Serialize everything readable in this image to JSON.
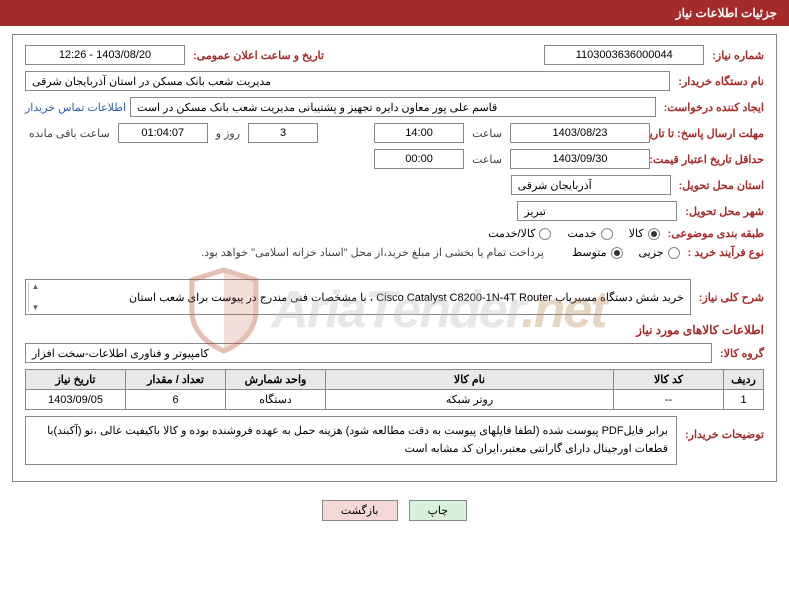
{
  "header": {
    "title": "جزئیات اطلاعات نیاز"
  },
  "fields": {
    "need_no_label": "شماره نیاز:",
    "need_no": "1103003636000044",
    "announce_label": "تاریخ و ساعت اعلان عمومی:",
    "announce_value": "1403/08/20 - 12:26",
    "buyer_org_label": "نام دستگاه خریدار:",
    "buyer_org": "مدیریت شعب بانک مسکن در استان آذربایجان شرقی",
    "requester_label": "ایجاد کننده درخواست:",
    "requester": "قاسم علی پور معاون دایره تجهیز و پشتیبانی مدیریت شعب بانک مسکن در است",
    "contact_link": "اطلاعات تماس خریدار",
    "deadline_send_label": "مهلت ارسال پاسخ: تا تاریخ:",
    "deadline_send_date": "1403/08/23",
    "time_label": "ساعت",
    "deadline_send_time": "14:00",
    "days_remain": "3",
    "days_and": "روز و",
    "time_remain": "01:04:07",
    "time_remain_suffix": "ساعت باقی مانده",
    "validity_label": "حداقل تاریخ اعتبار قیمت: تا تاریخ:",
    "validity_date": "1403/09/30",
    "validity_time": "00:00",
    "delivery_province_label": "استان محل تحویل:",
    "delivery_province": "آذربایجان شرقی",
    "delivery_city_label": "شهر محل تحویل:",
    "delivery_city": "تبریز",
    "category_label": "طبقه بندی موضوعی:",
    "radio_goods": "کالا",
    "radio_service": "خدمت",
    "radio_both": "کالا/خدمت",
    "purchase_type_label": "نوع فرآیند خرید :",
    "radio_minor": "جزیی",
    "radio_medium": "متوسط",
    "payment_note": "پرداخت تمام یا بخشی از مبلغ خرید،از محل \"اسناد خزانه اسلامی\" خواهد بود.",
    "summary_label": "شرح کلی نیاز:",
    "summary_text": "خرید شش دستگاه مسیریاب Cisco Catalyst C8200-1N-4T Router ، با مشخصات فنی مندرج در پیوست برای شعب استان",
    "items_section_title": "اطلاعات کالاهای مورد نیاز",
    "goods_group_label": "گروه کالا:",
    "goods_group": "کامپیوتر و فناوری اطلاعات-سخت افزار"
  },
  "table": {
    "headers": {
      "row": "ردیف",
      "code": "کد کالا",
      "name": "نام کالا",
      "unit": "واحد شمارش",
      "qty": "تعداد / مقدار",
      "date": "تاریخ نیاز"
    },
    "rows": [
      {
        "row": "1",
        "code": "--",
        "name": "روتر شبکه",
        "unit": "دستگاه",
        "qty": "6",
        "date": "1403/09/05"
      }
    ]
  },
  "buyer_notes": {
    "label": "توضیحات خریدار:",
    "text": "برابر فایلPDF پیوست شده (لطفا فایلهای پیوست به دقت مطالعه شود) هزینه حمل به عهده فروشنده بوده و کالا باکیفیت عالی ،نو (آکبند)با قطعات اورجینال دارای گارانتی معتبر،ایران کد مشابه است"
  },
  "buttons": {
    "print": "چاپ",
    "back": "بازگشت"
  },
  "watermark": {
    "text_main": "AriaTender",
    "text_suffix": ".net"
  }
}
